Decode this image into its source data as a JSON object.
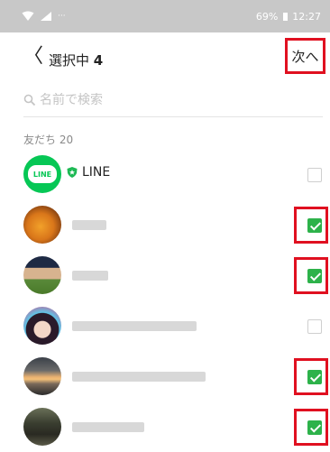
{
  "status_bar": {
    "battery_text": "69%",
    "time": "12:27"
  },
  "header": {
    "back_symbol": "〈",
    "title_prefix": "選択中",
    "selected_count": "4",
    "next_label": "次へ"
  },
  "search": {
    "placeholder": "名前で検索"
  },
  "friends": {
    "section_label": "友だち 20",
    "official": {
      "name": "LINE",
      "logo_text": "LINE",
      "checked": false
    },
    "items": [
      {
        "checked": true
      },
      {
        "checked": true
      },
      {
        "checked": false
      },
      {
        "checked": true
      },
      {
        "checked": true
      }
    ]
  },
  "colors": {
    "accent_green": "#2db24a",
    "highlight_red": "#e01020",
    "line_green": "#06c755"
  }
}
